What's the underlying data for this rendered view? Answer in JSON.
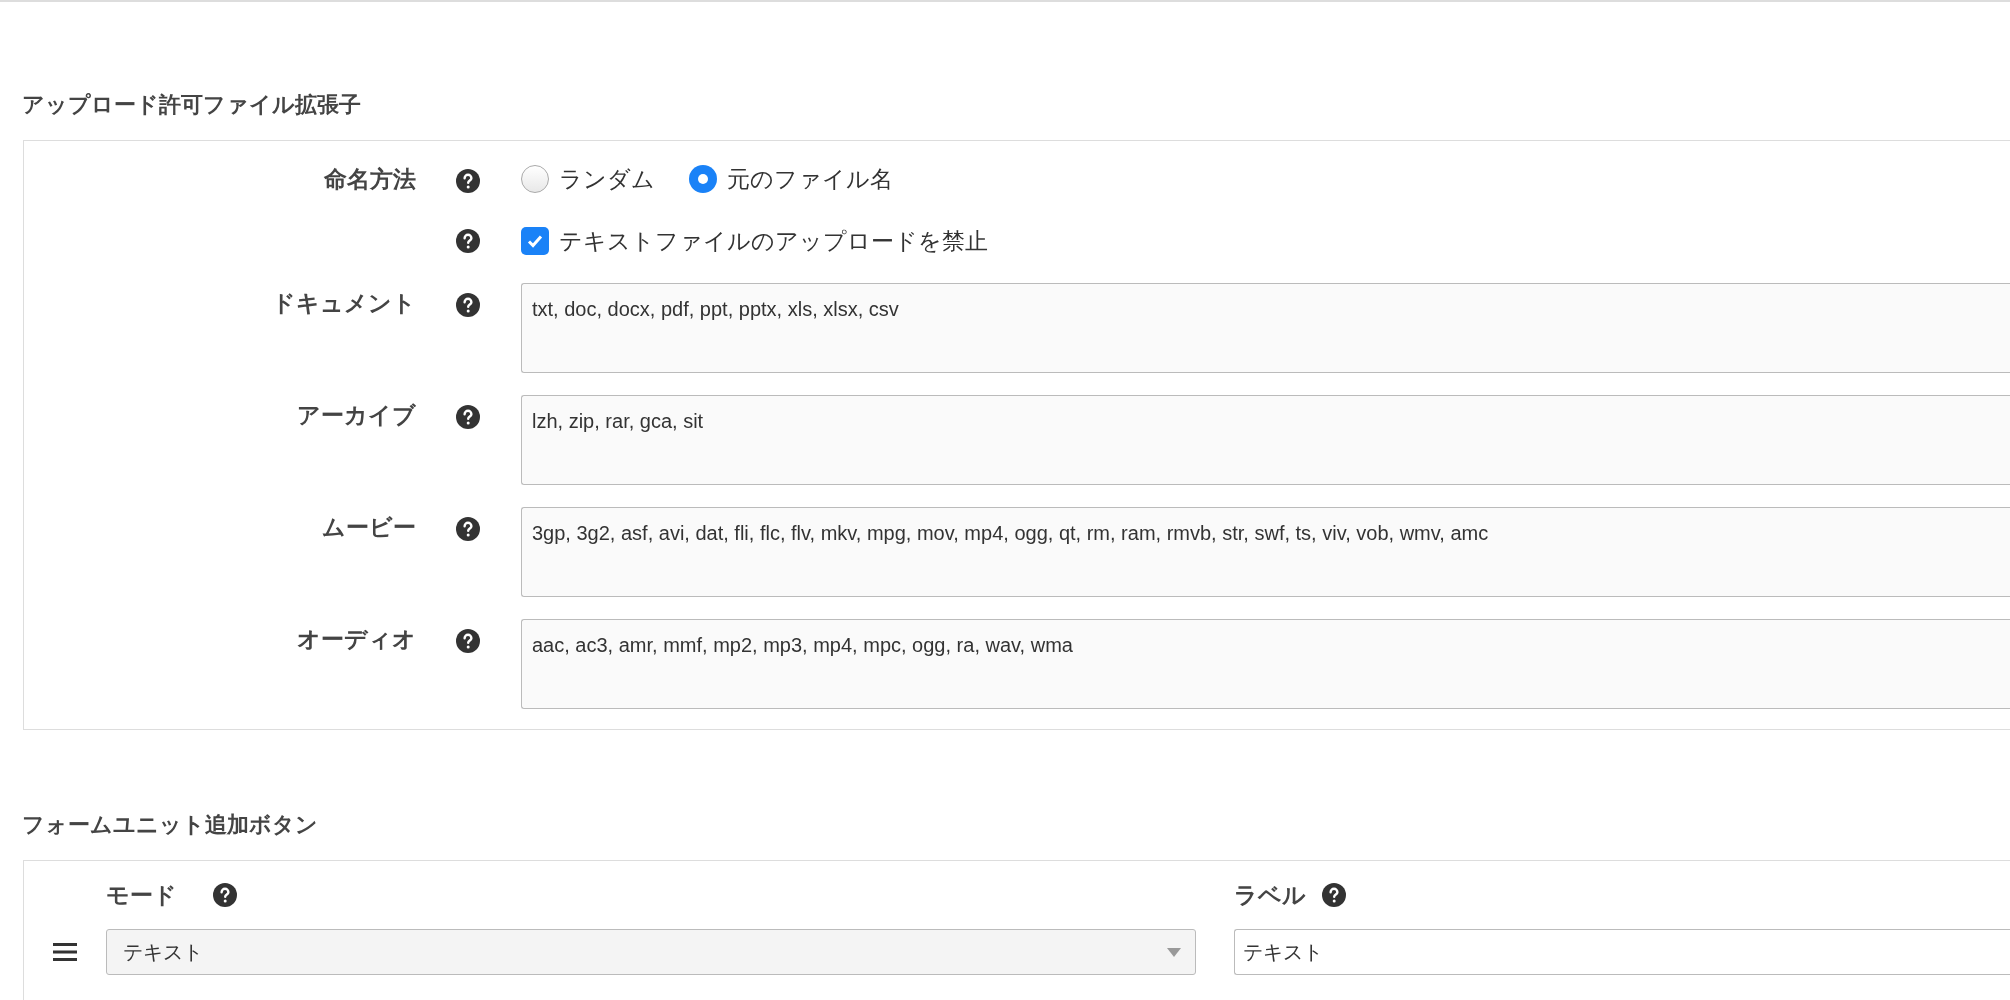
{
  "sections": [
    {
      "title": "アップロード許可ファイル拡張子",
      "fields": [
        {
          "kind": "radio",
          "label": "命名方法",
          "options": [
            {
              "label": "ランダム",
              "selected": false
            },
            {
              "label": "元のファイル名",
              "selected": true
            }
          ]
        },
        {
          "kind": "checkbox",
          "text": "テキストファイルのアップロードを禁止",
          "checked": true
        },
        {
          "kind": "textarea",
          "label": "ドキュメント",
          "value": "txt, doc, docx, pdf, ppt, pptx, xls, xlsx, csv"
        },
        {
          "kind": "textarea",
          "label": "アーカイブ",
          "value": "lzh, zip, rar, gca, sit"
        },
        {
          "kind": "textarea",
          "label": "ムービー",
          "value": "3gp, 3g2, asf, avi, dat, fli, flc, flv, mkv, mpg, mov, mp4, ogg, qt, rm, ram, rmvb, str, swf, ts, viv, vob, wmv, amc"
        },
        {
          "kind": "textarea",
          "label": "オーディオ",
          "value": "aac, ac3, amr, mmf, mp2, mp3, mp4, mpc, ogg, ra, wav, wma"
        }
      ]
    },
    {
      "title": "フォームユニット追加ボタン",
      "columns": [
        {
          "label": "モード"
        },
        {
          "label": "ラベル"
        }
      ],
      "rows": [
        {
          "mode": "テキスト",
          "label": "テキスト"
        }
      ]
    }
  ]
}
